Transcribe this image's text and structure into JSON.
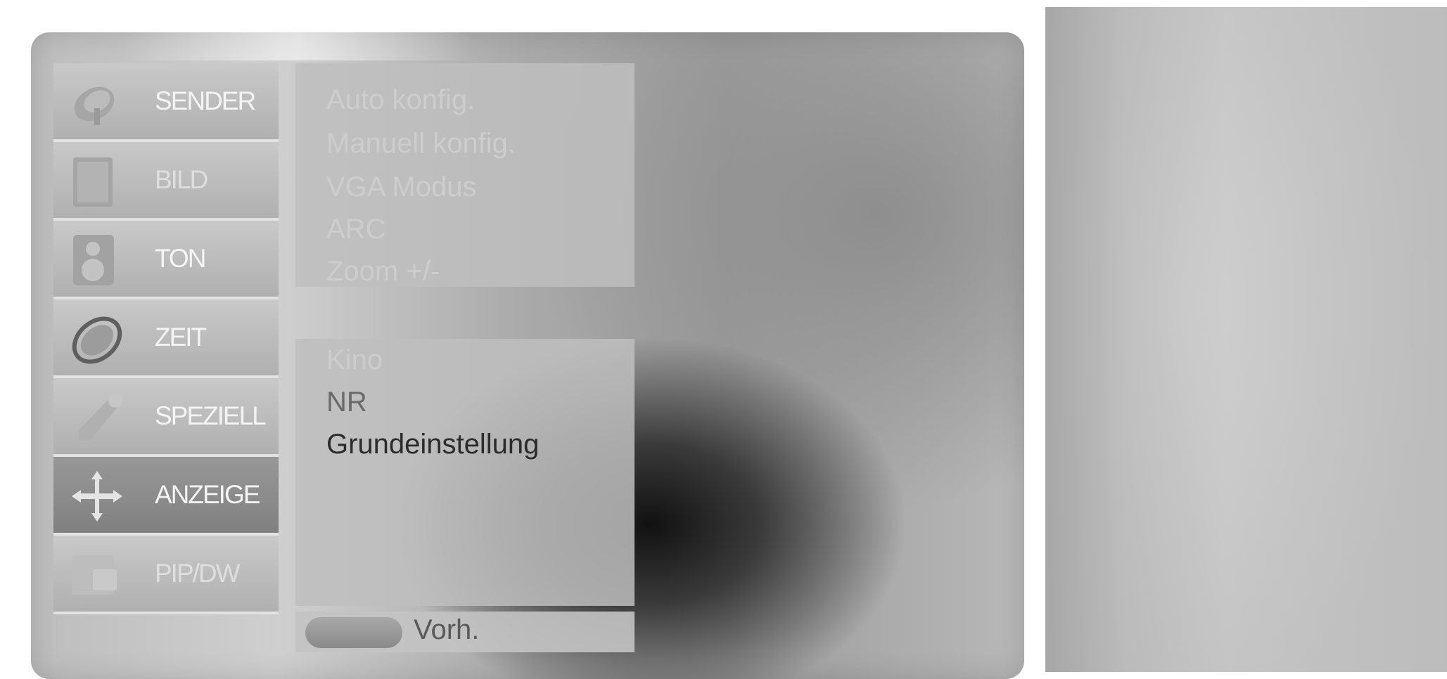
{
  "sidebar": {
    "items": [
      {
        "label": "SENDER",
        "icon": "satellite-dish-icon",
        "active": false
      },
      {
        "label": "BILD",
        "icon": "picture-icon",
        "active": false
      },
      {
        "label": "TON",
        "icon": "speaker-icon",
        "active": false
      },
      {
        "label": "ZEIT",
        "icon": "clock-icon",
        "active": false
      },
      {
        "label": "SPEZIELL",
        "icon": "wrench-icon",
        "active": false
      },
      {
        "label": "ANZEIGE",
        "icon": "move-arrows-icon",
        "active": true
      },
      {
        "label": "PIP/DW",
        "icon": "pip-icon",
        "active": false
      }
    ]
  },
  "submenu_top": {
    "items": [
      "Auto konfig.",
      "Manuell konfig.",
      "VGA Modus",
      "ARC",
      "Zoom +/-"
    ]
  },
  "submenu_bottom": {
    "items": [
      "Kino",
      "NR",
      "Grundeinstellung"
    ],
    "selected": "Grundeinstellung"
  },
  "footer": {
    "prev_label": "Vorh."
  },
  "colors": {
    "active_item": "#8a8a8a",
    "selected_text": "#2c2c2c"
  }
}
